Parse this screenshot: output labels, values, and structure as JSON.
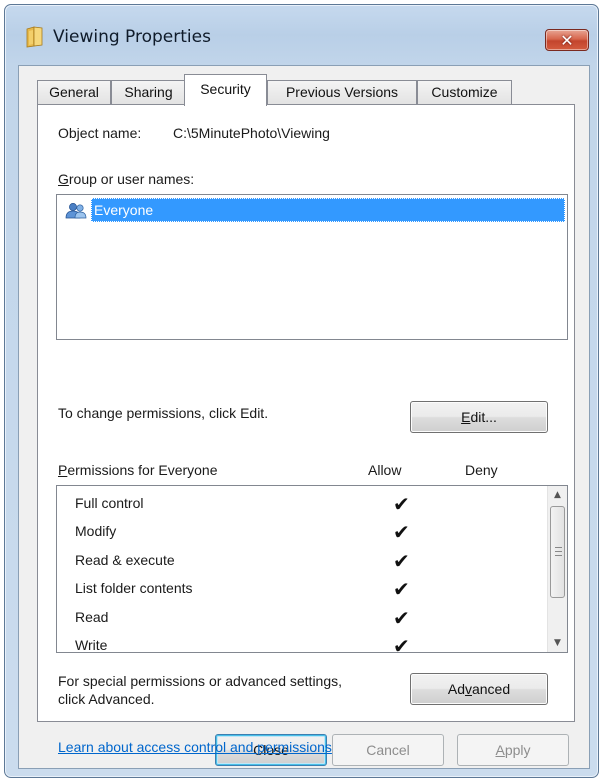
{
  "window": {
    "title": "Viewing Properties",
    "close_glyph": "✕"
  },
  "tabs": [
    {
      "label": "General"
    },
    {
      "label": "Sharing"
    },
    {
      "label": "Security",
      "active": true
    },
    {
      "label": "Previous Versions"
    },
    {
      "label": "Customize"
    }
  ],
  "security": {
    "object_name_label": "Object name:",
    "object_name_value": "C:\\5MinutePhoto\\Viewing",
    "group_label": "Group or user names:",
    "group_label_hotkey": "G",
    "group_label_rest": "roup or user names:",
    "users": [
      {
        "name": "Everyone",
        "selected": true,
        "icon": "users-icon"
      }
    ],
    "change_text": "To change permissions, click Edit.",
    "edit_button_hotkey": "E",
    "edit_button_rest": "dit...",
    "permissions_label_hotkey": "P",
    "permissions_label_rest": "ermissions for Everyone",
    "allow_header": "Allow",
    "deny_header": "Deny",
    "permissions": [
      {
        "name": "Full control",
        "allow": "✔",
        "deny": ""
      },
      {
        "name": "Modify",
        "allow": "✔",
        "deny": ""
      },
      {
        "name": "Read & execute",
        "allow": "✔",
        "deny": ""
      },
      {
        "name": "List folder contents",
        "allow": "✔",
        "deny": ""
      },
      {
        "name": "Read",
        "allow": "✔",
        "deny": ""
      },
      {
        "name": "Write",
        "allow": "✔",
        "deny": ""
      }
    ],
    "special_text_line1": "For special permissions or advanced settings,",
    "special_text_line2": "click Advanced.",
    "advanced_button_pre": "Ad",
    "advanced_button_hotkey": "v",
    "advanced_button_post": "anced",
    "learn_link": "Learn about access control and permissions"
  },
  "footer": {
    "close_label": "Close",
    "cancel_label": "Cancel",
    "apply_label_hotkey": "A",
    "apply_label_rest": "pply"
  },
  "colors": {
    "selection": "#3399ff",
    "link": "#0066cc",
    "close_button": "#c3452d"
  }
}
